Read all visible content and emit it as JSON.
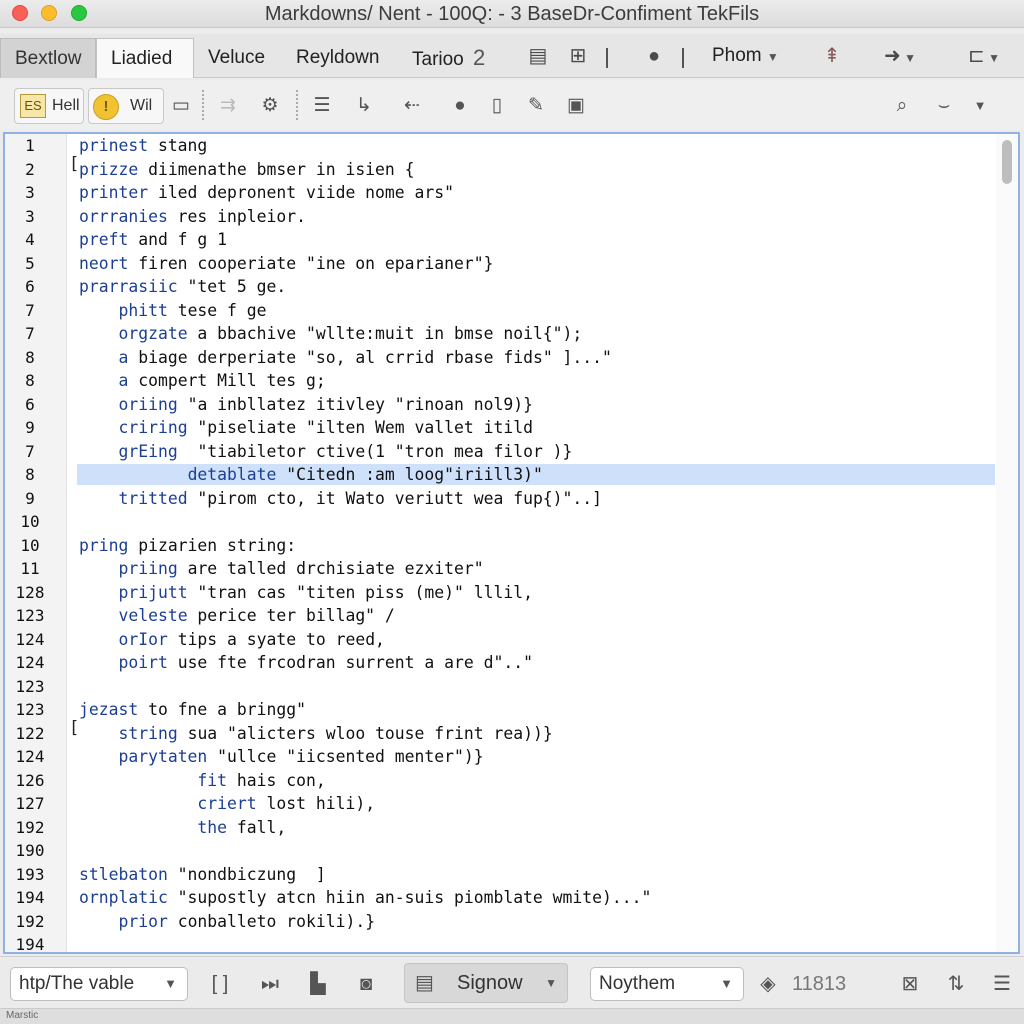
{
  "window": {
    "title": "Markdowns/ Nent - 100Q: - 3 BaseDr-Confiment TekFils"
  },
  "tabs": {
    "items": [
      "Bextlow",
      "Liadied",
      "Veluce",
      "Reyldown",
      "Tarioo"
    ],
    "tab_number": "2",
    "active": "Liadied",
    "phom_label": "Phom"
  },
  "toolbar": {
    "hell_label": "Hell",
    "wil_label": "Wil",
    "warn_glyph": "!"
  },
  "editor": {
    "highlighted_line_index": 13,
    "lines": [
      {
        "num": "1",
        "text": "prinest stang"
      },
      {
        "num": "2",
        "text": "prizze diimenathe bmser in isien {"
      },
      {
        "num": "3",
        "text": "printer iled depronent viide nome ars\""
      },
      {
        "num": "3",
        "text": "orrranies res inpleior."
      },
      {
        "num": "4",
        "text": "preft and f g 1"
      },
      {
        "num": "5",
        "text": "neort firen cooperiate \"ine on eparianer\"}"
      },
      {
        "num": "6",
        "text": "prarrasiic \"tet 5 ge."
      },
      {
        "num": "7",
        "text": "    phitt tese f ge"
      },
      {
        "num": "7",
        "text": "    orgzate a bbachive \"wllte:muit in bmse noil{\");"
      },
      {
        "num": "8",
        "text": "    a biage derperiate \"so, al crrid rbase fids\" ]...\""
      },
      {
        "num": "8",
        "text": "    a compert Mill tes g;"
      },
      {
        "num": "6",
        "text": "    oriing \"a inbllatez itivley \"rinoan nol9)}"
      },
      {
        "num": "9",
        "text": "    criring \"piseliate \"ilten Wem vallet itild"
      },
      {
        "num": "7",
        "text": "    grEing  \"tiabiletor ctive(1 \"tron mea filor )}"
      },
      {
        "num": "8",
        "text": "           detablate \"Citedn :am loog\"iriill3)\""
      },
      {
        "num": "9",
        "text": "    tritted \"pirom cto, it Wato veriutt wea fup{)\"..]"
      },
      {
        "num": "10",
        "text": ""
      },
      {
        "num": "10",
        "text": "pring pizarien string:"
      },
      {
        "num": "11",
        "text": "    priing are talled drchisiate ezxiter\""
      },
      {
        "num": "128",
        "text": "    prijutt \"tran cas \"titen piss (me)\" lllil,"
      },
      {
        "num": "123",
        "text": "    veleste perice ter billag\" /"
      },
      {
        "num": "124",
        "text": "    orIor tips a syate to reed,"
      },
      {
        "num": "124",
        "text": "    poirt use fte frcodran surrent a are d\"..\""
      },
      {
        "num": "123",
        "text": ""
      },
      {
        "num": "123",
        "text": "jezast to fne a bringg\""
      },
      {
        "num": "122",
        "text": "    string sua \"alicters wloo touse frint rea))}"
      },
      {
        "num": "124",
        "text": "    parytaten \"ullce \"iicsented menter\")}"
      },
      {
        "num": "126",
        "text": "            fit hais con,"
      },
      {
        "num": "127",
        "text": "            criert lost hili),"
      },
      {
        "num": "192",
        "text": "            the fall,"
      },
      {
        "num": "190",
        "text": ""
      },
      {
        "num": "193",
        "text": "stlebaton \"nondbiczung  ]"
      },
      {
        "num": "194",
        "text": "ornplatic \"supostly atcn hiin an-suis piomblate wmite)...\""
      },
      {
        "num": "192",
        "text": "    prior conballeto rokili).}"
      },
      {
        "num": "194",
        "text": ""
      }
    ]
  },
  "statusbar": {
    "path_select": "htp/The vable",
    "signow_label": "Signow",
    "encoding_select": "Noythem",
    "count": "11813"
  },
  "bottom": {
    "label": "Marstic"
  }
}
